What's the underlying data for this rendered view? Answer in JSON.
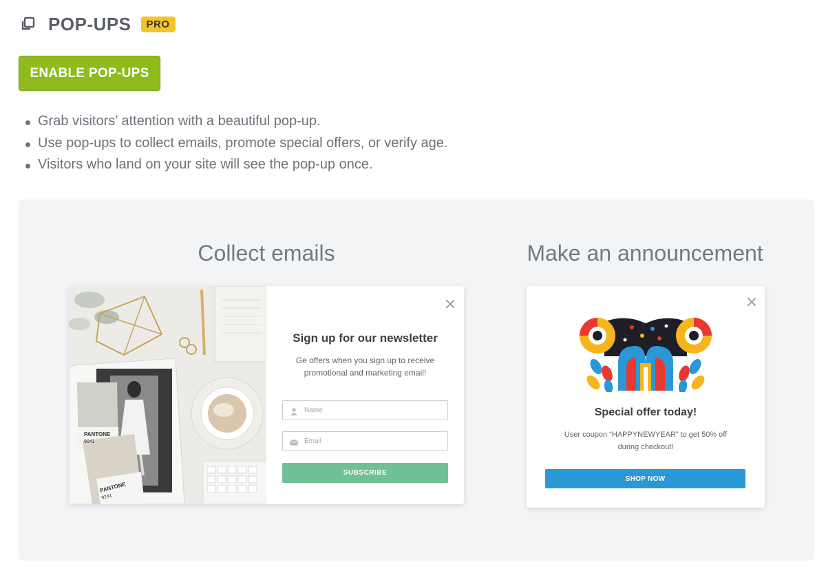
{
  "header": {
    "title": "POP-UPS",
    "badge": "PRO",
    "icon": "popups-icon"
  },
  "enable_button": {
    "label": "ENABLE POP-UPS"
  },
  "bullets": [
    "Grab visitors’ attention with a beautiful pop-up.",
    "Use pop-ups to collect emails, promote special offers, or verify age.",
    "Visitors who land on your site will see the pop-up once."
  ],
  "examples": {
    "collect": {
      "heading": "Collect emails",
      "popup": {
        "title": "Sign up for our newsletter",
        "description": "Ge offers when you sign up to receive promotional and marketing email!",
        "name_placeholder": "Name",
        "email_placeholder": "Email",
        "subscribe_label": "SUBSCRIBE",
        "pantone_top": "PANTONE",
        "pantone_top_code": "9041",
        "pantone_bottom": "PANTONE",
        "pantone_bottom_code": "9241"
      }
    },
    "announce": {
      "heading": "Make an announcement",
      "popup": {
        "title": "Special offer today!",
        "description": "User coupon “HAPPYNEWYEAR” to get 50% off during checkout!",
        "button_label": "SHOP NOW"
      }
    }
  },
  "colors": {
    "enable_button": "#8fbb1c",
    "pro_badge": "#f2c52d",
    "subscribe": "#6fc096",
    "shop_now": "#2a97d6",
    "panel_bg": "#f3f4f6"
  }
}
